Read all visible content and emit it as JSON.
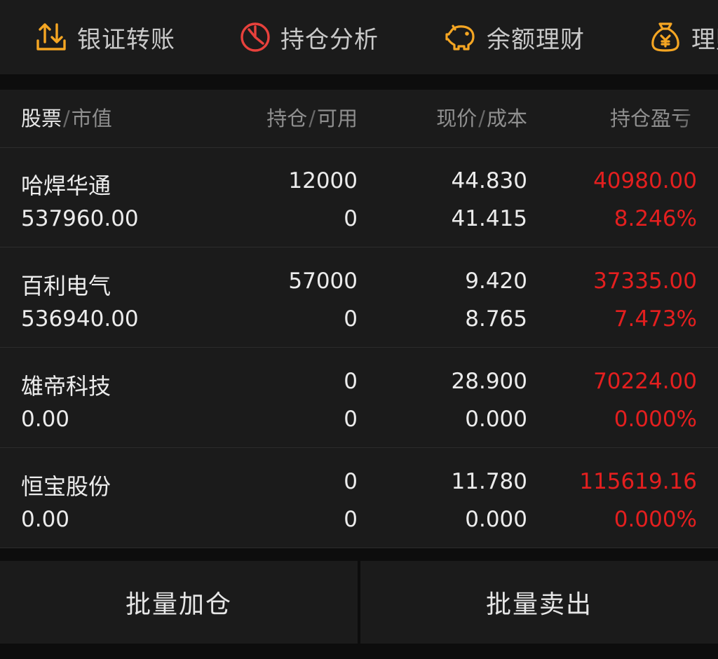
{
  "toolbar": {
    "items": [
      {
        "label": "银证转账",
        "icon": "transfer-icon"
      },
      {
        "label": "持仓分析",
        "icon": "pie-chart-icon"
      },
      {
        "label": "余额理财",
        "icon": "piggy-bank-icon"
      },
      {
        "label": "理财",
        "icon": "money-bag-icon"
      }
    ]
  },
  "table": {
    "headers": [
      {
        "primary": "股票",
        "secondary": "市值"
      },
      {
        "primary": "持仓",
        "secondary": "可用"
      },
      {
        "primary": "现价",
        "secondary": "成本"
      },
      {
        "primary": "持仓盈亏"
      }
    ],
    "rows": [
      {
        "name": "哈焊华通",
        "market_value": "537960.00",
        "position": "12000",
        "available": "0",
        "price": "44.830",
        "cost": "41.415",
        "pnl": "40980.00",
        "pnl_pct": "8.246%"
      },
      {
        "name": "百利电气",
        "market_value": "536940.00",
        "position": "57000",
        "available": "0",
        "price": "9.420",
        "cost": "8.765",
        "pnl": "37335.00",
        "pnl_pct": "7.473%"
      },
      {
        "name": "雄帝科技",
        "market_value": "0.00",
        "position": "0",
        "available": "0",
        "price": "28.900",
        "cost": "0.000",
        "pnl": "70224.00",
        "pnl_pct": "0.000%"
      },
      {
        "name": "恒宝股份",
        "market_value": "0.00",
        "position": "0",
        "available": "0",
        "price": "11.780",
        "cost": "0.000",
        "pnl": "115619.16",
        "pnl_pct": "0.000%"
      }
    ]
  },
  "footer": {
    "batch_add_label": "批量加仓",
    "batch_sell_label": "批量卖出"
  },
  "colors": {
    "up": "#e41f1f",
    "icon_orange": "#f5a623",
    "icon_red": "#e8413c"
  }
}
